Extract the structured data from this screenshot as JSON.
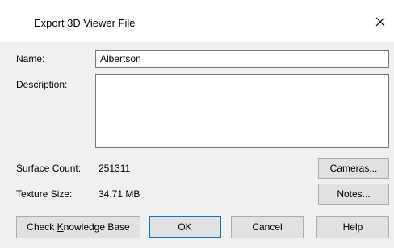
{
  "dialog": {
    "title": "Export 3D Viewer File"
  },
  "name_field": {
    "label": "Name:",
    "value": "Albertson"
  },
  "description_field": {
    "label": "Description:",
    "value": ""
  },
  "surface_count": {
    "label": "Surface Count:",
    "value": "251311"
  },
  "texture_size": {
    "label": "Texture Size:",
    "value": "34.71 MB"
  },
  "buttons": {
    "cameras": "Cameras...",
    "notes": "Notes...",
    "check_kb_pre": "Check ",
    "check_kb_mnemonic": "K",
    "check_kb_post": "nowledge Base",
    "ok": "OK",
    "cancel": "Cancel",
    "help": "Help"
  },
  "icons": {
    "close": "close-icon"
  },
  "colors": {
    "title_background": "#ffffff",
    "dialog_background": "#f0f0f0",
    "button_face": "#e1e1e1",
    "default_button_border": "#0078d7"
  }
}
